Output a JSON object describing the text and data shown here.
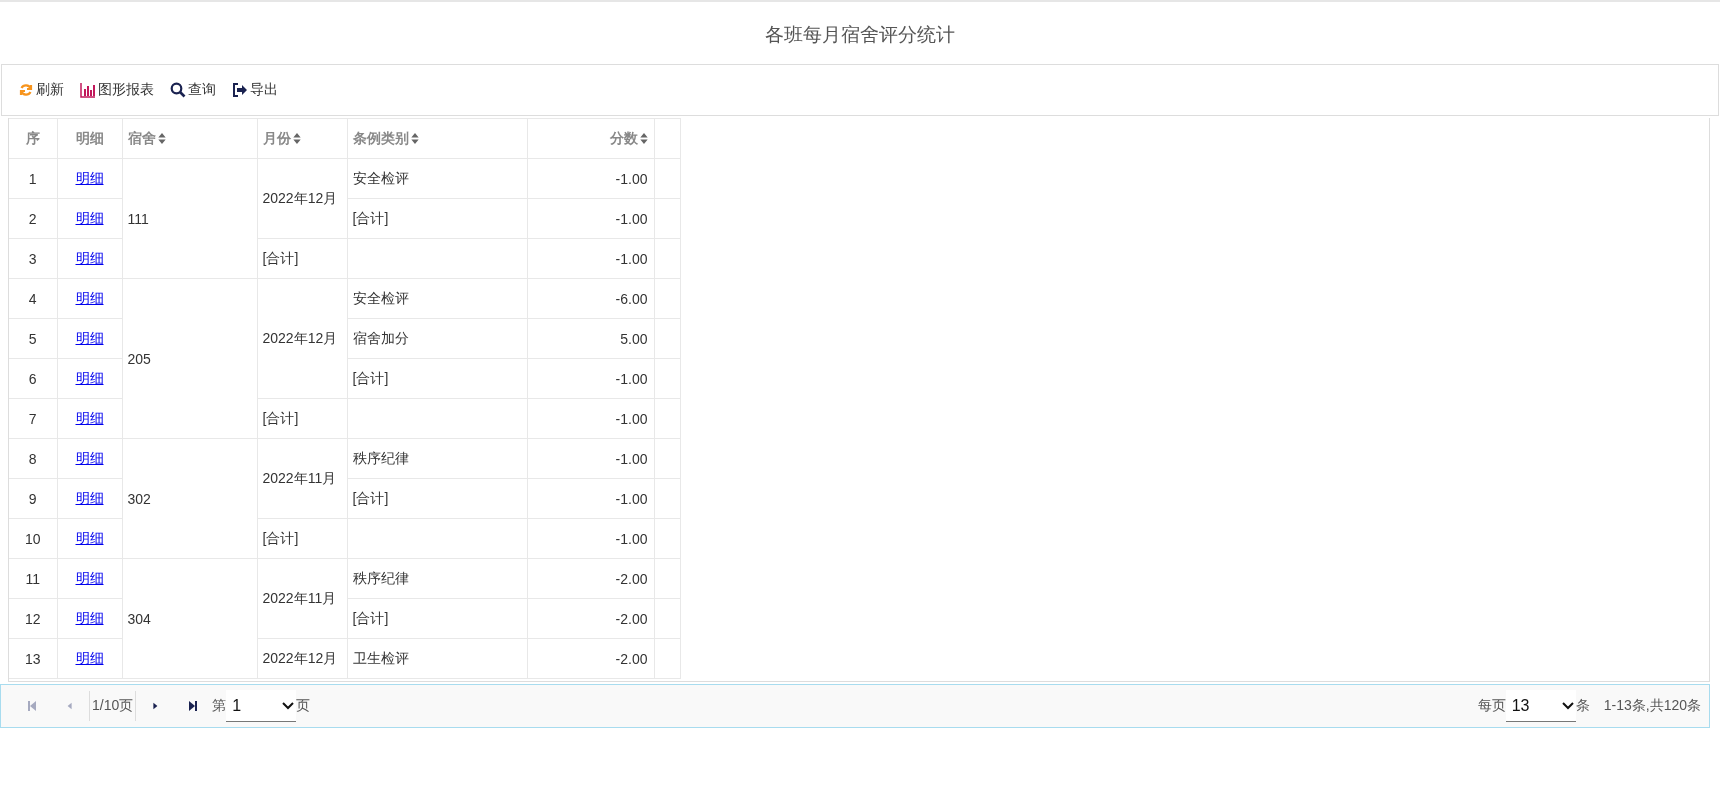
{
  "title": "各班每月宿舍评分统计",
  "toolbar": [
    {
      "kind": "refresh",
      "label": "刷新"
    },
    {
      "kind": "chart",
      "label": "图形报表"
    },
    {
      "kind": "search",
      "label": "查询"
    },
    {
      "kind": "export",
      "label": "导出"
    }
  ],
  "columns": [
    {
      "label": "序",
      "sortable": false
    },
    {
      "label": "明细",
      "sortable": false
    },
    {
      "label": "宿舍",
      "sortable": true
    },
    {
      "label": "月份",
      "sortable": true
    },
    {
      "label": "条例类别",
      "sortable": true
    },
    {
      "label": "分数",
      "sortable": true
    }
  ],
  "dorms": [
    {
      "dorm": "111",
      "months": [
        {
          "month": "2022年12月",
          "items": [
            {
              "no": "1",
              "link": "明细",
              "category": "安全检评",
              "score": "-1.00"
            },
            {
              "no": "2",
              "link": "明细",
              "category": "[合计]",
              "score": "-1.00"
            }
          ]
        },
        {
          "month": "[合计]",
          "items": [
            {
              "no": "3",
              "link": "明细",
              "score": "-1.00"
            }
          ]
        }
      ]
    },
    {
      "dorm": "205",
      "months": [
        {
          "month": "2022年12月",
          "items": [
            {
              "no": "4",
              "link": "明细",
              "category": "安全检评",
              "score": "-6.00"
            },
            {
              "no": "5",
              "link": "明细",
              "category": "宿舍加分",
              "score": "5.00"
            },
            {
              "no": "6",
              "link": "明细",
              "category": "[合计]",
              "score": "-1.00"
            }
          ]
        },
        {
          "month": "[合计]",
          "items": [
            {
              "no": "7",
              "link": "明细",
              "score": "-1.00"
            }
          ]
        }
      ]
    },
    {
      "dorm": "302",
      "months": [
        {
          "month": "2022年11月",
          "items": [
            {
              "no": "8",
              "link": "明细",
              "category": "秩序纪律",
              "score": "-1.00"
            },
            {
              "no": "9",
              "link": "明细",
              "category": "[合计]",
              "score": "-1.00"
            }
          ]
        },
        {
          "month": "[合计]",
          "items": [
            {
              "no": "10",
              "link": "明细",
              "score": "-1.00"
            }
          ]
        }
      ]
    },
    {
      "dorm": "304",
      "months": [
        {
          "month": "2022年11月",
          "items": [
            {
              "no": "11",
              "link": "明细",
              "category": "秩序纪律",
              "score": "-2.00"
            },
            {
              "no": "12",
              "link": "明细",
              "category": "[合计]",
              "score": "-2.00"
            }
          ]
        },
        {
          "month": "2022年12月",
          "items": [
            {
              "no": "13",
              "link": "明细",
              "category": "卫生检评",
              "score": "-2.00"
            }
          ]
        }
      ]
    }
  ],
  "pager": {
    "buttons": [
      {
        "kind": "first",
        "disabled": true
      },
      {
        "kind": "prev",
        "disabled": true
      },
      {
        "kind": "next",
        "disabled": false
      },
      {
        "kind": "last",
        "disabled": false
      }
    ],
    "page_info": "1/10页",
    "page_prefix": "第",
    "page": "1",
    "page_suffix": "页",
    "per_page_prefix": "每页",
    "per_page": "13",
    "per_page_suffix": "条",
    "summary": "1-13条,共120条"
  }
}
